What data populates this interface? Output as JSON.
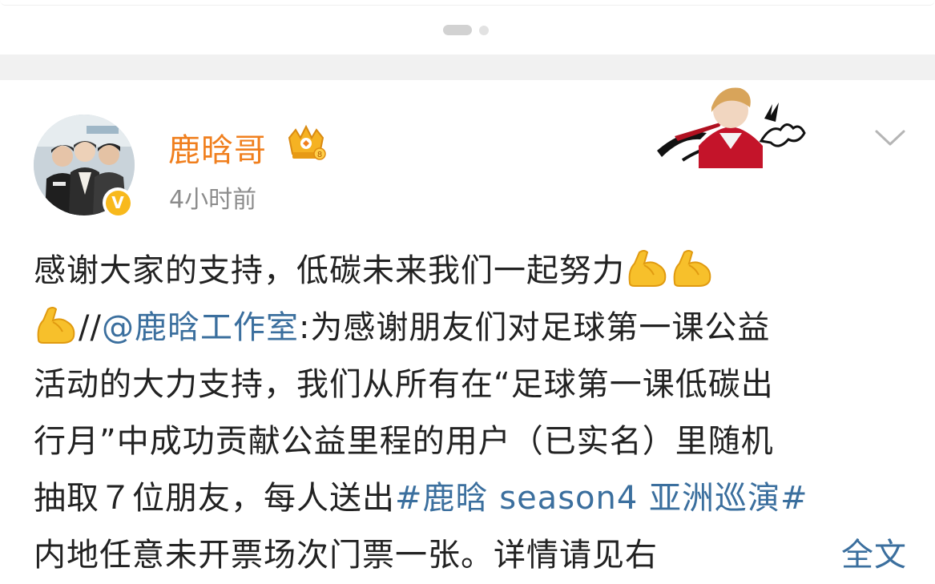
{
  "pager": {
    "active_index": 0,
    "count": 2
  },
  "post": {
    "author": {
      "name": "鹿晗哥",
      "verified": true,
      "verified_symbol": "V"
    },
    "timestamp": "4小时前",
    "text": {
      "l1": "感谢大家的支持，低碳未来我们一起努力",
      "l2_sep": "//",
      "l2_mention": "@鹿晗工作室",
      "l2_rest": ":为感谢朋友们对足球第一课公益",
      "l3": "活动的大力支持，我们从所有在“足球第一课低碳出",
      "l4": "行月”中成功贡献公益里程的用户（已实名）里随机",
      "l5_pre": "抽取７位朋友，每人送出",
      "l5_tag": "#鹿晗 season4 亚洲巡演#",
      "l6": "内地任意未开票场次门票一张。详情请见右",
      "expand": "全文"
    },
    "icons": {
      "emoji": "flexed-biceps",
      "badge": "crown",
      "menu": "chevron-down"
    },
    "colors": {
      "username": "#f07f1e",
      "link": "#3b6f9e",
      "text": "#222222",
      "meta": "#8c8c8c"
    }
  }
}
